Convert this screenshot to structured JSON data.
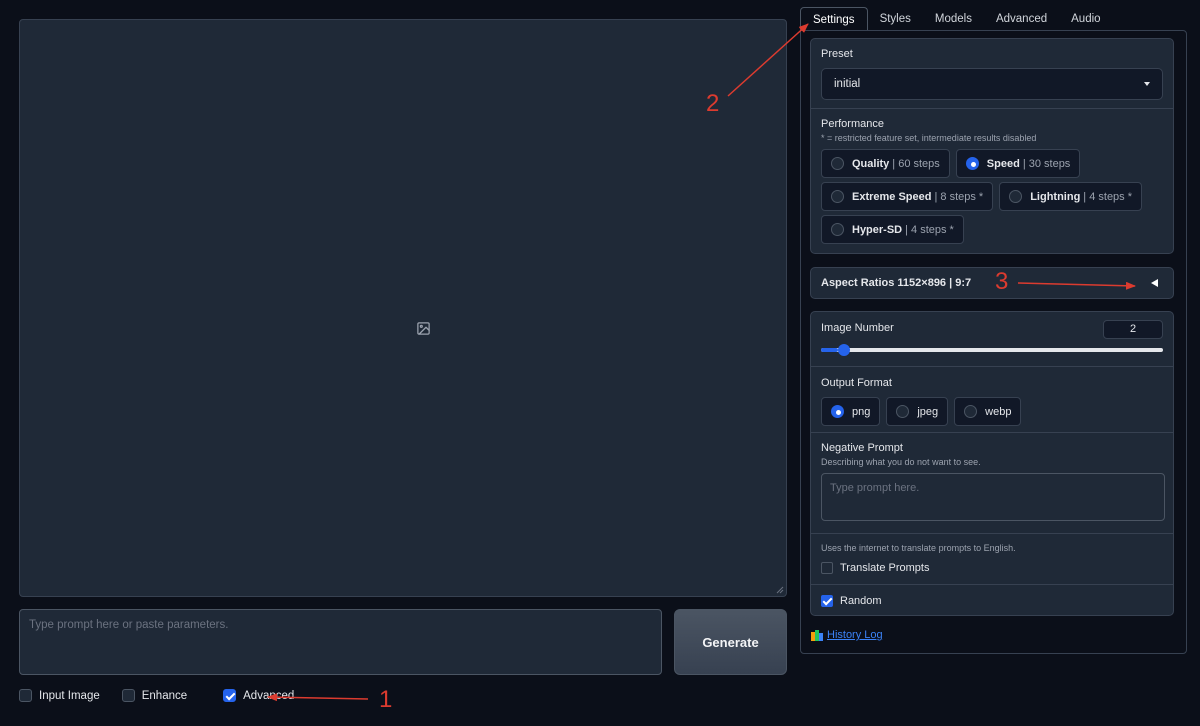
{
  "prompt": {
    "placeholder": "Type prompt here or paste parameters."
  },
  "generate_label": "Generate",
  "bottom_options": [
    {
      "label": "Input Image",
      "checked": false
    },
    {
      "label": "Enhance",
      "checked": false
    },
    {
      "label": "Advanced",
      "checked": true
    }
  ],
  "tabs": [
    "Settings",
    "Styles",
    "Models",
    "Advanced",
    "Audio"
  ],
  "active_tab": "Settings",
  "preset": {
    "label": "Preset",
    "value": "initial"
  },
  "performance": {
    "label": "Performance",
    "hint": "* = restricted feature set, intermediate results disabled",
    "options": [
      {
        "main": "Quality",
        "sub": "| 60 steps",
        "selected": false
      },
      {
        "main": "Speed",
        "sub": "| 30 steps",
        "selected": true
      },
      {
        "main": "Extreme Speed",
        "sub": "| 8 steps *",
        "selected": false
      },
      {
        "main": "Lightning",
        "sub": "| 4 steps *",
        "selected": false
      },
      {
        "main": "Hyper-SD",
        "sub": "| 4 steps *",
        "selected": false
      }
    ]
  },
  "aspect_ratios": {
    "label": "Aspect Ratios 1152×896 | 9:7"
  },
  "image_number": {
    "label": "Image Number",
    "value": "2",
    "fraction": 0.05
  },
  "output_format": {
    "label": "Output Format",
    "options": [
      {
        "main": "png",
        "selected": true
      },
      {
        "main": "jpeg",
        "selected": false
      },
      {
        "main": "webp",
        "selected": false
      }
    ]
  },
  "negative_prompt": {
    "label": "Negative Prompt",
    "hint": "Describing what you do not want to see.",
    "placeholder": "Type prompt here."
  },
  "translate": {
    "hint": "Uses the internet to translate prompts to English.",
    "label": "Translate Prompts",
    "checked": false
  },
  "random": {
    "label": "Random",
    "checked": true
  },
  "history_log": "History Log",
  "annotations": [
    "1",
    "2",
    "3"
  ],
  "colors": {
    "accent": "#2563eb",
    "annotation": "#dc3b2f",
    "background": "#0b0f19",
    "panel": "#1f2937"
  }
}
